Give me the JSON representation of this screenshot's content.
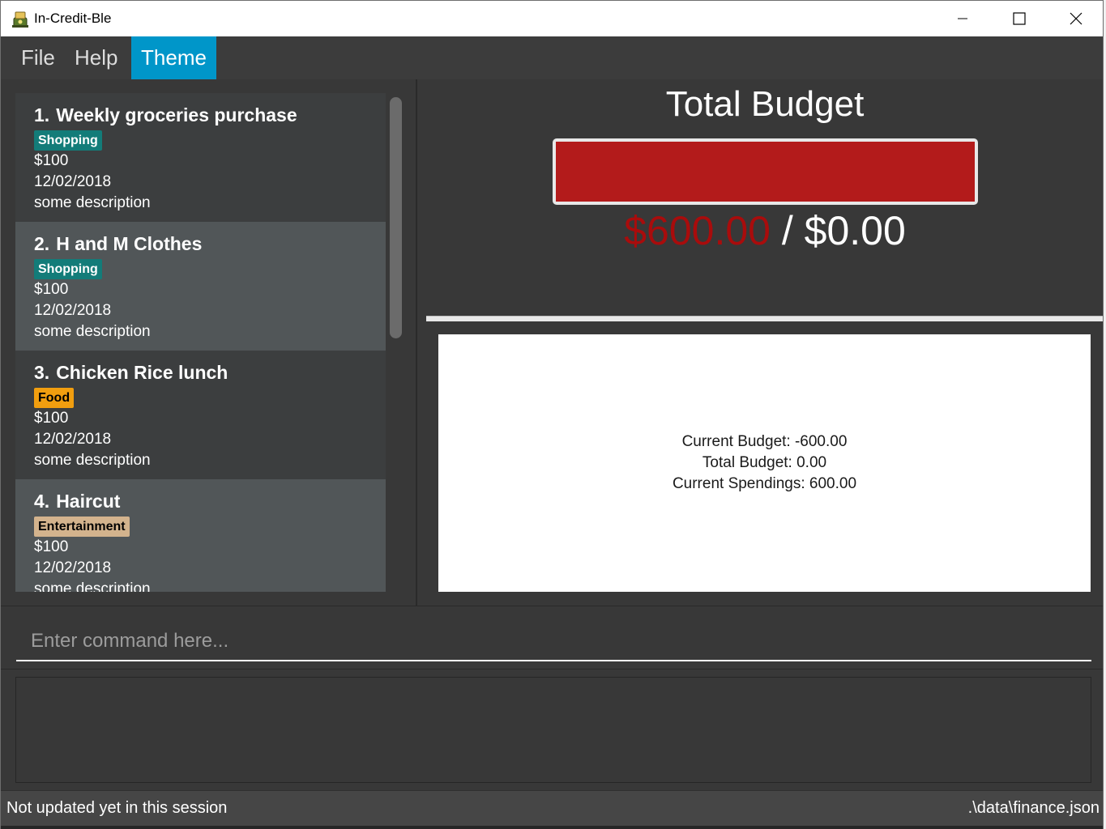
{
  "window": {
    "title": "In-Credit-Ble",
    "minimize_glyph": "—",
    "maximize_glyph": "☐",
    "close_glyph": "✕"
  },
  "menu": {
    "items": [
      {
        "label": "File"
      },
      {
        "label": "Help"
      },
      {
        "label": "Theme",
        "active": true
      }
    ]
  },
  "expenses": {
    "items": [
      {
        "index": "1.",
        "name": "Weekly groceries purchase",
        "tag": "Shopping",
        "tag_color": "#137c79",
        "tag_text_color": "#ffffff",
        "amount": "$100",
        "date": "12/02/2018",
        "description": "some description"
      },
      {
        "index": "2.",
        "name": "H and M Clothes",
        "tag": "Shopping",
        "tag_color": "#137c79",
        "tag_text_color": "#ffffff",
        "amount": "$100",
        "date": "12/02/2018",
        "description": "some description"
      },
      {
        "index": "3.",
        "name": "Chicken Rice lunch",
        "tag": "Food",
        "tag_color": "#f19e0f",
        "tag_text_color": "#000000",
        "amount": "$100",
        "date": "12/02/2018",
        "description": "some description"
      },
      {
        "index": "4.",
        "name": "Haircut",
        "tag": "Entertainment",
        "tag_color": "#d3b38d",
        "tag_text_color": "#000000",
        "amount": "$100",
        "date": "12/02/2018",
        "description": "some description"
      }
    ]
  },
  "budget": {
    "title": "Total Budget",
    "spent": "$600.00",
    "separator": " / ",
    "total": "$0.00",
    "bar_fill_fraction": 1.0,
    "bar_color": "#b31b1b",
    "spent_color": "#a90c0c"
  },
  "info": {
    "current_budget": "Current Budget: -600.00",
    "total_budget": "Total Budget: 0.00",
    "current_spendings": "Current Spendings: 600.00"
  },
  "command": {
    "placeholder": "Enter command here..."
  },
  "status": {
    "sync": "Not updated yet in this session",
    "file_path": ".\\data\\finance.json"
  }
}
